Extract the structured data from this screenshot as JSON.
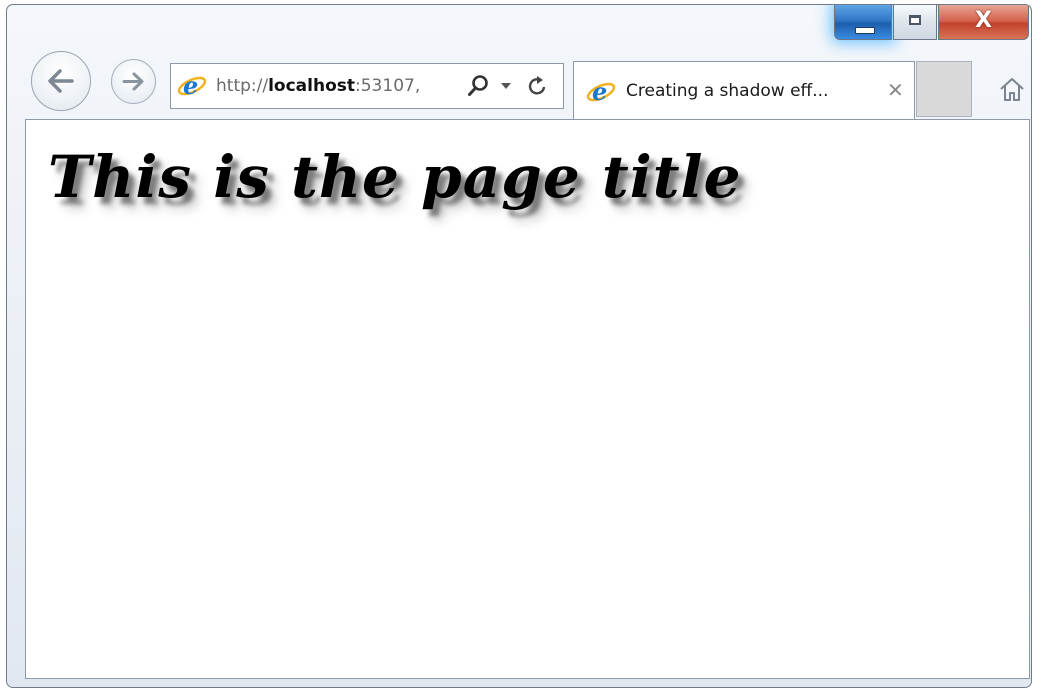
{
  "window": {
    "caption_buttons": {
      "minimize_icon": "minimize-icon",
      "maximize_icon": "restore-icon",
      "close_glyph": "X",
      "minimize_accent": "#2f78c8",
      "close_accent": "#c2432c"
    }
  },
  "navigation": {
    "back_icon": "back-arrow-icon",
    "forward_icon": "forward-arrow-icon",
    "home_icon": "home-icon"
  },
  "address_bar": {
    "url_prefix": "http://",
    "url_host": "localhost",
    "url_rest": ":53107,",
    "site_icon": "internet-explorer-icon",
    "search_icon": "search-icon",
    "dropdown_icon": "chevron-down-icon",
    "refresh_icon": "refresh-icon"
  },
  "tabs": [
    {
      "title": "Creating a shadow eff...",
      "icon": "internet-explorer-icon",
      "close_glyph": "✕",
      "active": true
    }
  ],
  "page": {
    "title": "This is the page title",
    "background": "#ffffff",
    "title_color": "#000000"
  }
}
